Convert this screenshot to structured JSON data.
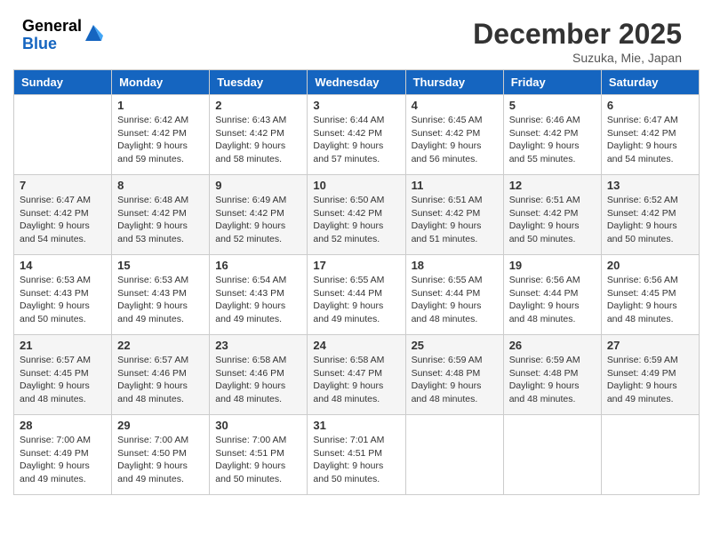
{
  "header": {
    "logo_general": "General",
    "logo_blue": "Blue",
    "month_title": "December 2025",
    "subtitle": "Suzuka, Mie, Japan"
  },
  "weekdays": [
    "Sunday",
    "Monday",
    "Tuesday",
    "Wednesday",
    "Thursday",
    "Friday",
    "Saturday"
  ],
  "weeks": [
    [
      {
        "day": "",
        "sunrise": "",
        "sunset": "",
        "daylight": ""
      },
      {
        "day": "1",
        "sunrise": "Sunrise: 6:42 AM",
        "sunset": "Sunset: 4:42 PM",
        "daylight": "Daylight: 9 hours and 59 minutes."
      },
      {
        "day": "2",
        "sunrise": "Sunrise: 6:43 AM",
        "sunset": "Sunset: 4:42 PM",
        "daylight": "Daylight: 9 hours and 58 minutes."
      },
      {
        "day": "3",
        "sunrise": "Sunrise: 6:44 AM",
        "sunset": "Sunset: 4:42 PM",
        "daylight": "Daylight: 9 hours and 57 minutes."
      },
      {
        "day": "4",
        "sunrise": "Sunrise: 6:45 AM",
        "sunset": "Sunset: 4:42 PM",
        "daylight": "Daylight: 9 hours and 56 minutes."
      },
      {
        "day": "5",
        "sunrise": "Sunrise: 6:46 AM",
        "sunset": "Sunset: 4:42 PM",
        "daylight": "Daylight: 9 hours and 55 minutes."
      },
      {
        "day": "6",
        "sunrise": "Sunrise: 6:47 AM",
        "sunset": "Sunset: 4:42 PM",
        "daylight": "Daylight: 9 hours and 54 minutes."
      }
    ],
    [
      {
        "day": "7",
        "sunrise": "Sunrise: 6:47 AM",
        "sunset": "Sunset: 4:42 PM",
        "daylight": "Daylight: 9 hours and 54 minutes."
      },
      {
        "day": "8",
        "sunrise": "Sunrise: 6:48 AM",
        "sunset": "Sunset: 4:42 PM",
        "daylight": "Daylight: 9 hours and 53 minutes."
      },
      {
        "day": "9",
        "sunrise": "Sunrise: 6:49 AM",
        "sunset": "Sunset: 4:42 PM",
        "daylight": "Daylight: 9 hours and 52 minutes."
      },
      {
        "day": "10",
        "sunrise": "Sunrise: 6:50 AM",
        "sunset": "Sunset: 4:42 PM",
        "daylight": "Daylight: 9 hours and 52 minutes."
      },
      {
        "day": "11",
        "sunrise": "Sunrise: 6:51 AM",
        "sunset": "Sunset: 4:42 PM",
        "daylight": "Daylight: 9 hours and 51 minutes."
      },
      {
        "day": "12",
        "sunrise": "Sunrise: 6:51 AM",
        "sunset": "Sunset: 4:42 PM",
        "daylight": "Daylight: 9 hours and 50 minutes."
      },
      {
        "day": "13",
        "sunrise": "Sunrise: 6:52 AM",
        "sunset": "Sunset: 4:42 PM",
        "daylight": "Daylight: 9 hours and 50 minutes."
      }
    ],
    [
      {
        "day": "14",
        "sunrise": "Sunrise: 6:53 AM",
        "sunset": "Sunset: 4:43 PM",
        "daylight": "Daylight: 9 hours and 50 minutes."
      },
      {
        "day": "15",
        "sunrise": "Sunrise: 6:53 AM",
        "sunset": "Sunset: 4:43 PM",
        "daylight": "Daylight: 9 hours and 49 minutes."
      },
      {
        "day": "16",
        "sunrise": "Sunrise: 6:54 AM",
        "sunset": "Sunset: 4:43 PM",
        "daylight": "Daylight: 9 hours and 49 minutes."
      },
      {
        "day": "17",
        "sunrise": "Sunrise: 6:55 AM",
        "sunset": "Sunset: 4:44 PM",
        "daylight": "Daylight: 9 hours and 49 minutes."
      },
      {
        "day": "18",
        "sunrise": "Sunrise: 6:55 AM",
        "sunset": "Sunset: 4:44 PM",
        "daylight": "Daylight: 9 hours and 48 minutes."
      },
      {
        "day": "19",
        "sunrise": "Sunrise: 6:56 AM",
        "sunset": "Sunset: 4:44 PM",
        "daylight": "Daylight: 9 hours and 48 minutes."
      },
      {
        "day": "20",
        "sunrise": "Sunrise: 6:56 AM",
        "sunset": "Sunset: 4:45 PM",
        "daylight": "Daylight: 9 hours and 48 minutes."
      }
    ],
    [
      {
        "day": "21",
        "sunrise": "Sunrise: 6:57 AM",
        "sunset": "Sunset: 4:45 PM",
        "daylight": "Daylight: 9 hours and 48 minutes."
      },
      {
        "day": "22",
        "sunrise": "Sunrise: 6:57 AM",
        "sunset": "Sunset: 4:46 PM",
        "daylight": "Daylight: 9 hours and 48 minutes."
      },
      {
        "day": "23",
        "sunrise": "Sunrise: 6:58 AM",
        "sunset": "Sunset: 4:46 PM",
        "daylight": "Daylight: 9 hours and 48 minutes."
      },
      {
        "day": "24",
        "sunrise": "Sunrise: 6:58 AM",
        "sunset": "Sunset: 4:47 PM",
        "daylight": "Daylight: 9 hours and 48 minutes."
      },
      {
        "day": "25",
        "sunrise": "Sunrise: 6:59 AM",
        "sunset": "Sunset: 4:48 PM",
        "daylight": "Daylight: 9 hours and 48 minutes."
      },
      {
        "day": "26",
        "sunrise": "Sunrise: 6:59 AM",
        "sunset": "Sunset: 4:48 PM",
        "daylight": "Daylight: 9 hours and 48 minutes."
      },
      {
        "day": "27",
        "sunrise": "Sunrise: 6:59 AM",
        "sunset": "Sunset: 4:49 PM",
        "daylight": "Daylight: 9 hours and 49 minutes."
      }
    ],
    [
      {
        "day": "28",
        "sunrise": "Sunrise: 7:00 AM",
        "sunset": "Sunset: 4:49 PM",
        "daylight": "Daylight: 9 hours and 49 minutes."
      },
      {
        "day": "29",
        "sunrise": "Sunrise: 7:00 AM",
        "sunset": "Sunset: 4:50 PM",
        "daylight": "Daylight: 9 hours and 49 minutes."
      },
      {
        "day": "30",
        "sunrise": "Sunrise: 7:00 AM",
        "sunset": "Sunset: 4:51 PM",
        "daylight": "Daylight: 9 hours and 50 minutes."
      },
      {
        "day": "31",
        "sunrise": "Sunrise: 7:01 AM",
        "sunset": "Sunset: 4:51 PM",
        "daylight": "Daylight: 9 hours and 50 minutes."
      },
      {
        "day": "",
        "sunrise": "",
        "sunset": "",
        "daylight": ""
      },
      {
        "day": "",
        "sunrise": "",
        "sunset": "",
        "daylight": ""
      },
      {
        "day": "",
        "sunrise": "",
        "sunset": "",
        "daylight": ""
      }
    ]
  ]
}
